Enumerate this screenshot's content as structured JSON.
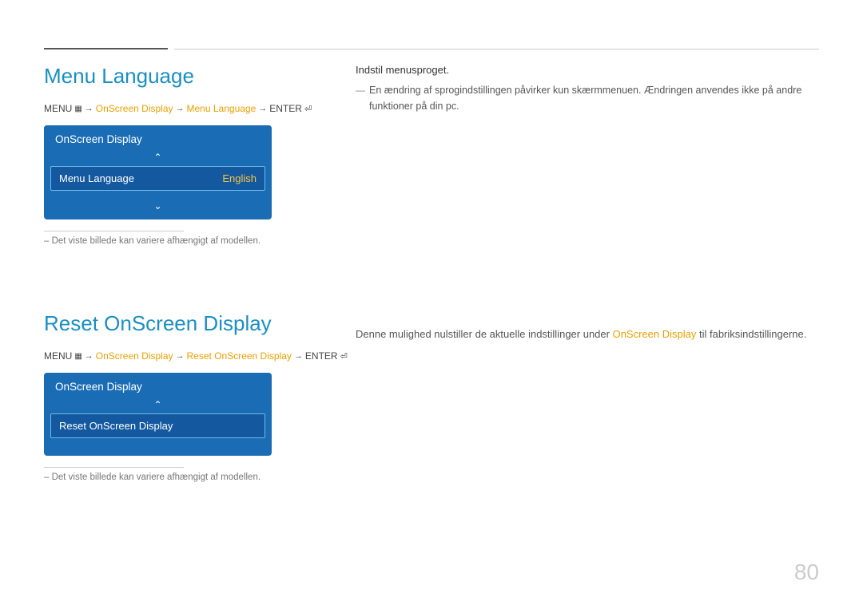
{
  "page": {
    "number": "80"
  },
  "top_rule": {},
  "section1": {
    "title": "Menu Language",
    "breadcrumb": {
      "menu": "MENU",
      "menu_icon": "⊞",
      "arrow1": "→",
      "link1": "OnScreen Display",
      "arrow2": "→",
      "link2": "Menu Language",
      "arrow3": "→",
      "enter": "ENTER",
      "enter_icon": "↵"
    },
    "osd_box": {
      "header": "OnScreen Display",
      "row_label": "Menu Language",
      "row_value": "English"
    },
    "divider_note": "– Det viste billede kan variere afhængigt af modellen."
  },
  "section1_info": {
    "title": "Indstil menusproget.",
    "body": "En ændring af sprogindstillingen påvirker kun skærmmenuen. Ændringen anvendes ikke på andre funktioner på din pc."
  },
  "section2": {
    "title": "Reset OnScreen Display",
    "breadcrumb": {
      "menu": "MENU",
      "menu_icon": "⊞",
      "arrow1": "→",
      "link1": "OnScreen Display",
      "arrow2": "→",
      "link2": "Reset OnScreen Display",
      "arrow3": "→",
      "enter": "ENTER",
      "enter_icon": "↵"
    },
    "osd_box": {
      "header": "OnScreen Display",
      "row_label": "Reset OnScreen Display"
    },
    "divider_note": "– Det viste billede kan variere afhængigt af modellen."
  },
  "section2_info": {
    "prefix": "Denne mulighed nulstiller de aktuelle indstillinger under ",
    "link": "OnScreen Display",
    "suffix": " til fabriksindstillingerne."
  }
}
